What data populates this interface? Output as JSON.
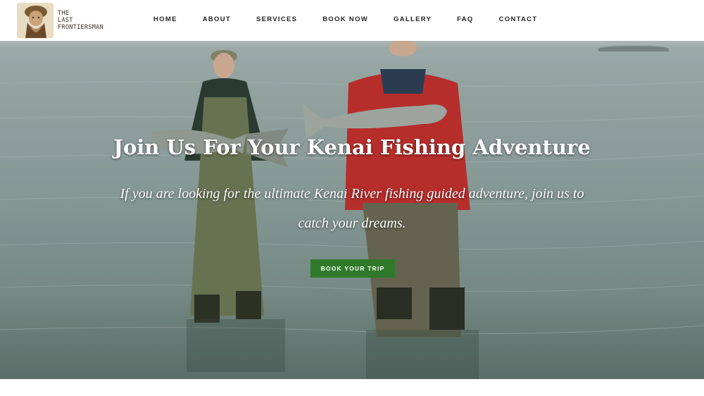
{
  "brand": {
    "logo_text": "THE\nLAST\nFRONTIERSMAN",
    "logo_icon": "frontiersman-portrait-icon"
  },
  "nav": {
    "items": [
      {
        "label": "HOME"
      },
      {
        "label": "ABOUT"
      },
      {
        "label": "SERVICES"
      },
      {
        "label": "BOOK NOW"
      },
      {
        "label": "GALLERY"
      },
      {
        "label": "FAQ"
      },
      {
        "label": "CONTACT"
      }
    ]
  },
  "hero": {
    "title": "Join Us For Your Kenai Fishing Adventure",
    "subtitle": "If you are looking for the ultimate Kenai River fishing guided adventure, join us to catch your dreams.",
    "cta_label": "BOOK YOUR TRIP",
    "cta_color": "#2f7a2a"
  }
}
